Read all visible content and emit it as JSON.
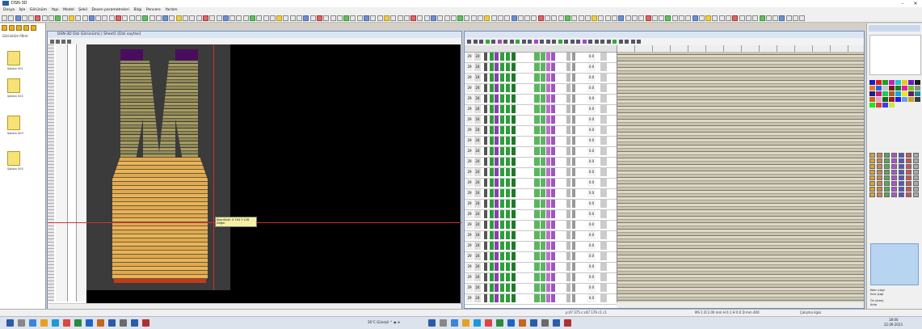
{
  "window": {
    "title": "DSN-3D",
    "minimize": "–",
    "close": "✕"
  },
  "menu": [
    "Dosya",
    "İşle",
    "Görünüm",
    "Yapı",
    "Model",
    "Şekil",
    "Desen parametreleri",
    "Bilgi",
    "Pencere",
    "Yardım"
  ],
  "left_panel": {
    "label": "Görüntüle filtrel",
    "thumbs": [
      "Şablon 001",
      "Şablon 002",
      "Şablon 003",
      "Şablon 004"
    ]
  },
  "design_window": {
    "title": "DSN-3D Dizi Görünümü | Sheet1 [Dizi sayfası]",
    "tooltip_line1": "Koordinat: X 194 Y 128",
    "tooltip_line2": "Değer"
  },
  "instruction_window": {
    "row_numbers": [
      "29",
      "29",
      "29",
      "29",
      "29",
      "29",
      "29",
      "29",
      "29",
      "29",
      "29",
      "29",
      "29",
      "29",
      "29",
      "29",
      "29",
      "29",
      "29",
      "29",
      "29",
      "29",
      "29",
      "29"
    ],
    "row_counts": [
      "24",
      "24",
      "24",
      "24",
      "24",
      "24",
      "24",
      "24",
      "24",
      "24",
      "24",
      "24",
      "24",
      "24",
      "24",
      "24",
      "24",
      "24",
      "24",
      "24",
      "24",
      "24",
      "24",
      "24"
    ],
    "row_values": [
      "0.0",
      "0.0",
      "0.0",
      "0.0",
      "0.0",
      "0.0",
      "0.0",
      "0.0",
      "0.0",
      "0.0",
      "0.0",
      "0.0",
      "0.0",
      "0.0",
      "0.0",
      "0.0",
      "0.0",
      "0.0",
      "0.0",
      "0.0",
      "0.0",
      "0.0",
      "0.0",
      "0.0"
    ]
  },
  "palette": {
    "radio_options_1": [
      "Kalın çizgi",
      "İnce çizgi"
    ],
    "radio_options_2": [
      "Ön yüzey",
      "Arka"
    ],
    "swatch_colors": [
      "#1c1cc8",
      "#e01c1c",
      "#1ca01c",
      "#c81cc8",
      "#1cc8c8",
      "#e8c81c",
      "#6a1cc8",
      "#1c1c1c",
      "#e87c1c",
      "#1c64e8",
      "#c8c8c8",
      "#7c1c1c",
      "#1c7c1c",
      "#e81ca0",
      "#64c81c",
      "#8c8c8c",
      "#1c1c8c",
      "#c81c64",
      "#1cc864",
      "#a0641c",
      "#1ca0e8",
      "#e8e81c",
      "#641c64",
      "#1c8c8c",
      "#c8641c",
      "#e8a0c8",
      "#1c641c",
      "#a01c1c",
      "#1c1ce8",
      "#64a0e8",
      "#c8a01c",
      "#3c3c3c",
      "#1ce81c",
      "#e83c3c",
      "#3c3ce8",
      "#c8e83c"
    ]
  },
  "status": {
    "left": "p:47 375 c:c47 176 c1 c1",
    "right": "MS 1  D:2.00 mm  H 0.1  H 0.0 D mm  400",
    "zoom": "Çalışma ilgisi"
  },
  "taskbar": {
    "center_text": "26°C Güneşli  ^  ◉  ⊕",
    "time": "18:00",
    "date": "22.09.2023"
  },
  "colors": {
    "accent": "#2a5caa",
    "canvas": "#000000",
    "garment_body": "#e1a94d",
    "garment_straps": "#8f8a5c",
    "rib_purple": "#4a0d5e",
    "hem_red": "#c83a14"
  }
}
